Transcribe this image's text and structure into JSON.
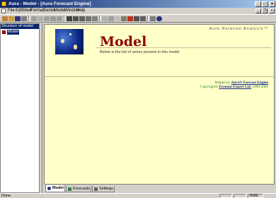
{
  "window": {
    "title": "Aura - Model - [Aura Forecast Engine]"
  },
  "menu": [
    "File",
    "Edit",
    "View",
    "Format",
    "Series",
    "Model",
    "Window",
    "Help"
  ],
  "window_buttons": {
    "minimize": "_",
    "maximize": "□",
    "close": "×"
  },
  "mdi_buttons": {
    "minimize": "_",
    "restore": "❐",
    "close": "×"
  },
  "sidebar": {
    "header": "Structure of model",
    "items": [
      {
        "label": "Model"
      }
    ]
  },
  "content": {
    "brand": "Auto Relation Analysis™",
    "title": "Model",
    "subtitle": "Below is the list of series present in this model",
    "footer": {
      "helped_by_prefix": "Helped by",
      "engine_name": "Aura® Forecast Engine",
      "copyright_prefix": "Copyright©",
      "company": "Econom-Expert Ltd.",
      "years": "1999-2001"
    }
  },
  "tabs": [
    {
      "label": "Model",
      "active": true
    },
    {
      "label": "Forecasts",
      "active": false
    },
    {
      "label": "Settings",
      "active": false
    }
  ],
  "status": {
    "text": "Done",
    "panel": "NUM"
  },
  "colors": {
    "title_red": "#8b0000",
    "content_bg": "#ffffc8",
    "selection": "#0a246a"
  }
}
